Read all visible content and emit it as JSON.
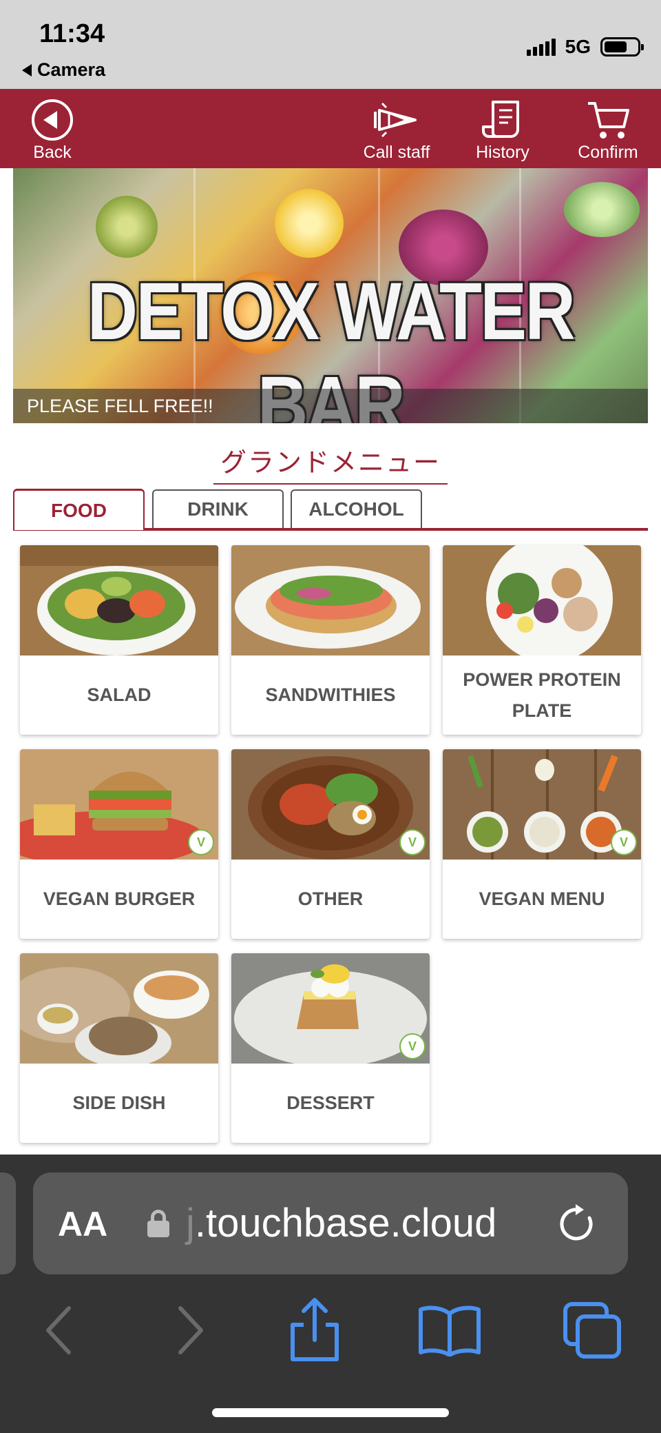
{
  "status_bar": {
    "time": "11:34",
    "back_app": "Camera",
    "network": "5G"
  },
  "header": {
    "back_label": "Back",
    "call_staff_label": "Call staff",
    "history_label": "History",
    "confirm_label": "Confirm",
    "bg_color": "#9b2335"
  },
  "banner": {
    "title": "DETOX WATER BAR",
    "caption": "PLEASE FELL FREE!!"
  },
  "menu_title": "グランドメニュー",
  "tabs": [
    {
      "label": "FOOD",
      "active": true
    },
    {
      "label": "DRINK",
      "active": false
    },
    {
      "label": "ALCOHOL",
      "active": false
    }
  ],
  "menu_items": [
    {
      "label": "SALAD",
      "vegan": false
    },
    {
      "label": "SANDWITHIES",
      "vegan": false
    },
    {
      "label": "POWER PROTEIN PLATE",
      "vegan": false
    },
    {
      "label": "VEGAN BURGER",
      "vegan": true
    },
    {
      "label": "OTHER",
      "vegan": true
    },
    {
      "label": "VEGAN MENU",
      "vegan": true
    },
    {
      "label": "SIDE DISH",
      "vegan": false
    },
    {
      "label": "DESSERT",
      "vegan": true
    }
  ],
  "browser": {
    "text_size_label": "AA",
    "url_faded": "j",
    "url": ".touchbase.cloud"
  }
}
